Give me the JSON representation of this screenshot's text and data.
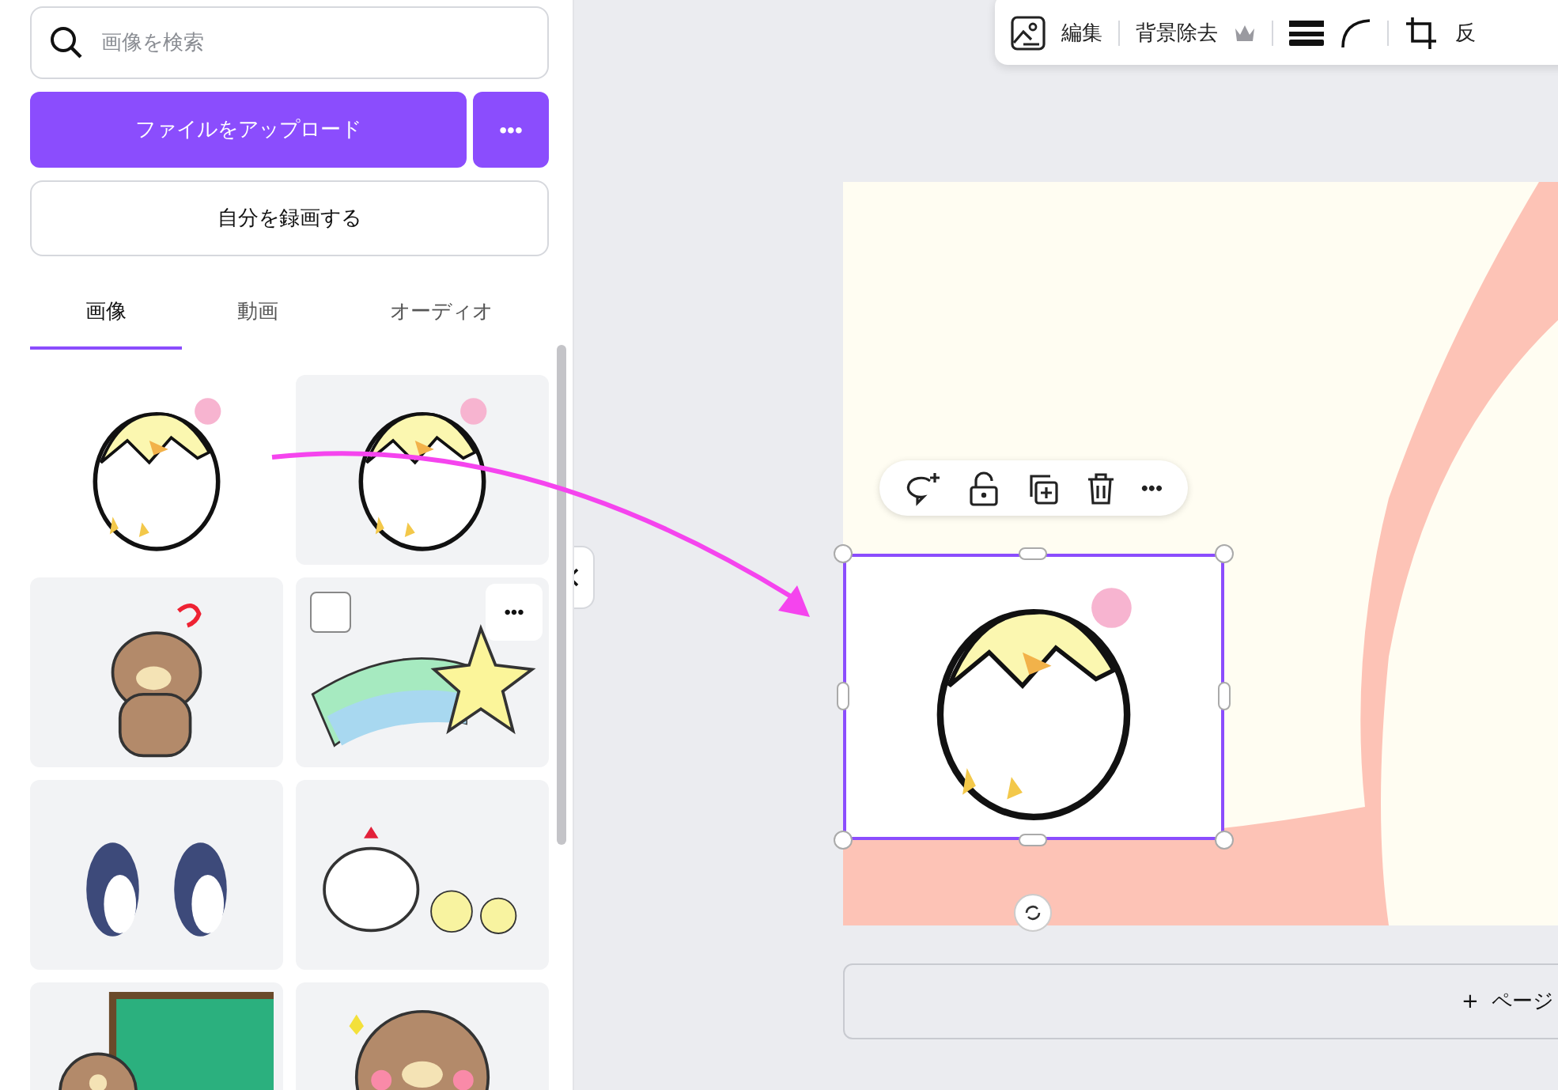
{
  "search": {
    "placeholder": "画像を検索"
  },
  "upload_button": "ファイルをアップロード",
  "upload_more_button": "•••",
  "record_button": "自分を録画する",
  "tabs": [
    {
      "label": "画像",
      "selected": true
    },
    {
      "label": "動画",
      "selected": false
    },
    {
      "label": "オーディオ",
      "selected": false
    }
  ],
  "uploads": [
    {
      "kind": "picture",
      "dragging": true,
      "hovered": false
    },
    {
      "kind": "picture",
      "dragging": false,
      "hovered": false
    },
    {
      "kind": "picture",
      "dragging": false,
      "hovered": false
    },
    {
      "kind": "picture",
      "dragging": false,
      "hovered": true
    },
    {
      "kind": "picture",
      "dragging": false,
      "hovered": false
    },
    {
      "kind": "picture",
      "dragging": false,
      "hovered": false
    },
    {
      "kind": "picture",
      "dragging": false,
      "hovered": false
    },
    {
      "kind": "picture",
      "dragging": false,
      "hovered": false
    }
  ],
  "tile_more_button": "•••",
  "toolbar": {
    "edit": "編集",
    "remove_background": "背景除去",
    "cut_label": "反"
  },
  "element_toolbar": {
    "more_button": "•••"
  },
  "add_page": {
    "plus": "+",
    "label": "ページ"
  }
}
